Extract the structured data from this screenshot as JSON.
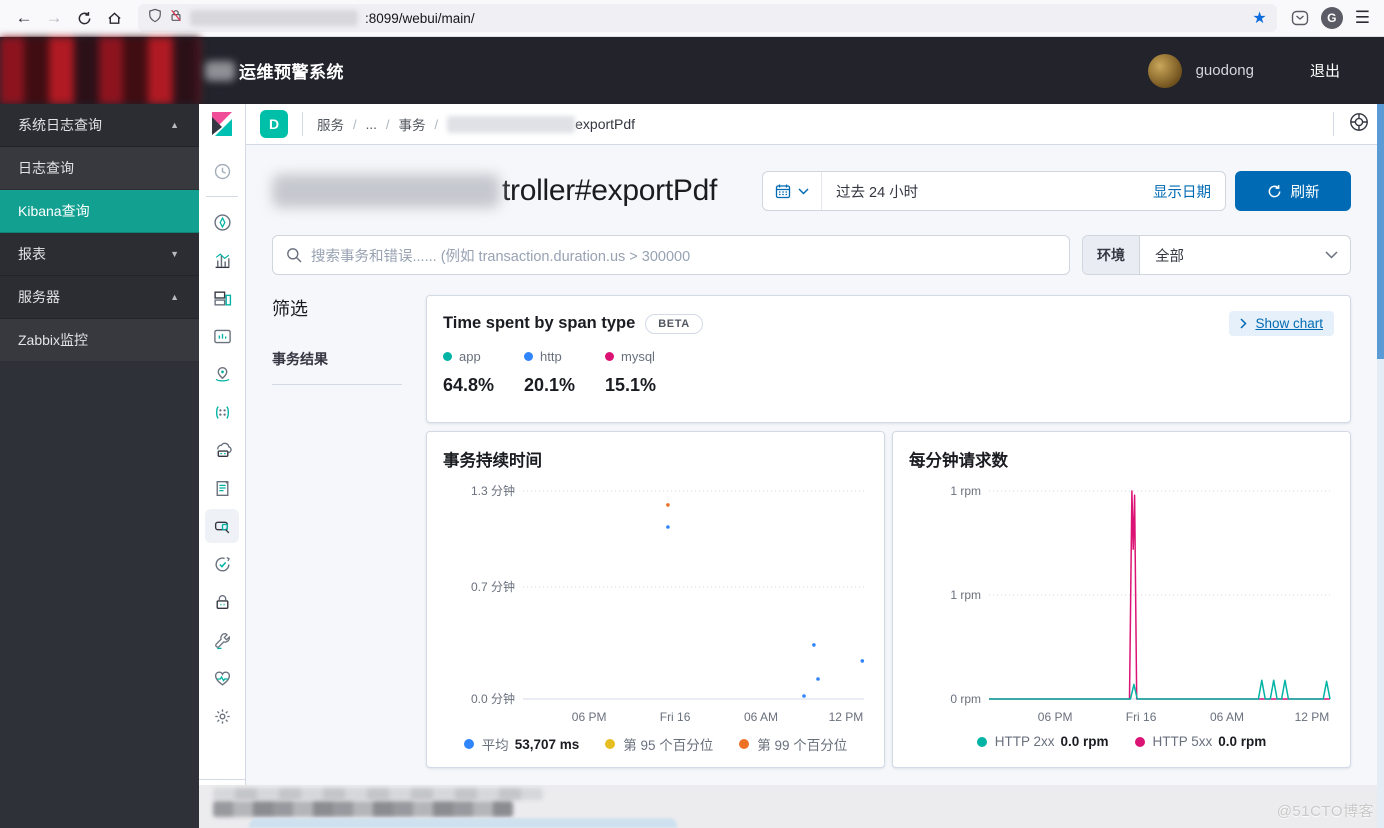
{
  "browser": {
    "url_visible": ":8099/webui/main/"
  },
  "header": {
    "title": "运维预警系统",
    "user": "guodong",
    "logout": "退出"
  },
  "sidebar": {
    "items": [
      {
        "label": "系统日志查询",
        "arrow": "▲"
      },
      {
        "label": "日志查询",
        "arrow": ""
      },
      {
        "label": "Kibana查询",
        "arrow": ""
      },
      {
        "label": "报表",
        "arrow": "▼"
      },
      {
        "label": "服务器",
        "arrow": "▲"
      },
      {
        "label": "Zabbix监控",
        "arrow": ""
      }
    ]
  },
  "breadcrumb": {
    "badge": "D",
    "item1": "服务",
    "item2": "...",
    "item3": "事务",
    "sep": "/",
    "last_visible": "exportPdf"
  },
  "page": {
    "title_visible": "troller#exportPdf"
  },
  "timepicker": {
    "value": "过去 24 小时",
    "show_dates": "显示日期",
    "refresh": "刷新"
  },
  "search": {
    "placeholder": "搜索事务和错误...... (例如 transaction.duration.us > 300000"
  },
  "env": {
    "label": "环境",
    "value": "全部"
  },
  "filter": {
    "title": "筛选",
    "result_label": "事务结果"
  },
  "span_panel": {
    "beta_label": "BETA",
    "show_chart_label": "Show chart"
  },
  "chart_data": [
    {
      "type": "summary",
      "title": "Time spent by span type",
      "items": [
        {
          "label": "app",
          "value": "64.8%",
          "color": "#00B3A4"
        },
        {
          "label": "http",
          "value": "20.1%",
          "color": "#3185FC"
        },
        {
          "label": "mysql",
          "value": "15.1%",
          "color": "#DB1374"
        }
      ]
    },
    {
      "type": "scatter",
      "title": "事务持续时间",
      "ylabel": "分钟",
      "ymax": 1.3,
      "grid": "dotted",
      "legend_position": "bottom-center",
      "y_ticks": [
        {
          "label": "1.3 分钟",
          "value": 1.3
        },
        {
          "label": "0.7 分钟",
          "value": 0.7
        },
        {
          "label": "0.0 分钟",
          "value": 0
        }
      ],
      "x_ticks": [
        {
          "label": "06 PM",
          "frac": 0.194
        },
        {
          "label": "Fri 16",
          "frac": 0.446
        },
        {
          "label": "06 AM",
          "frac": 0.698
        },
        {
          "label": "12 PM",
          "frac": 0.947
        }
      ],
      "series": [
        {
          "name": "平均",
          "type": "scatter",
          "color": "#3185FC",
          "points": [
            [
              0.425,
              1.075
            ],
            [
              0.853,
              0.338
            ],
            [
              0.995,
              0.238
            ],
            [
              0.865,
              0.125
            ],
            [
              0.824,
              0.019
            ]
          ]
        },
        {
          "name": "第 95 个百分位",
          "type": "scatter",
          "color": "#E7BE22",
          "points": []
        },
        {
          "name": "第 99 个百分位",
          "type": "scatter",
          "color": "#EE7125",
          "points": [
            [
              0.425,
              1.213
            ]
          ]
        }
      ],
      "legend": [
        {
          "label": "平均",
          "value": "53,707 ms",
          "color": "#3185FC"
        },
        {
          "label": "第 95 个百分位",
          "value": "",
          "color": "#E7BE22"
        },
        {
          "label": "第 99 个百分位",
          "value": "",
          "color": "#EE7125"
        }
      ]
    },
    {
      "type": "line",
      "title": "每分钟请求数",
      "ylabel": "rpm",
      "ymax": 1.0,
      "grid": "dotted",
      "legend_position": "bottom-center",
      "y_ticks": [
        {
          "label": "1 rpm",
          "value": 1
        },
        {
          "label": "1 rpm",
          "value": 0.5
        },
        {
          "label": "0 rpm",
          "value": 0
        }
      ],
      "x_ticks": [
        {
          "label": "06 PM",
          "frac": 0.194
        },
        {
          "label": "Fri 16",
          "frac": 0.446
        },
        {
          "label": "06 AM",
          "frac": 0.698
        },
        {
          "label": "12 PM",
          "frac": 0.947
        }
      ],
      "series": [
        {
          "name": "HTTP 5xx",
          "type": "line",
          "color": "#DB1374",
          "points": [
            [
              0,
              0
            ],
            [
              0.412,
              0
            ],
            [
              0.419,
              1.0
            ],
            [
              0.423,
              0.72
            ],
            [
              0.427,
              0.98
            ],
            [
              0.433,
              0
            ],
            [
              1,
              0
            ]
          ]
        },
        {
          "name": "HTTP 2xx",
          "type": "line",
          "color": "#00B3A4",
          "points": [
            [
              0,
              0
            ],
            [
              0.415,
              0
            ],
            [
              0.425,
              0.07
            ],
            [
              0.435,
              0
            ],
            [
              0.79,
              0
            ],
            [
              0.8,
              0.09
            ],
            [
              0.81,
              0
            ],
            [
              0.825,
              0
            ],
            [
              0.835,
              0.09
            ],
            [
              0.845,
              0
            ],
            [
              0.858,
              0
            ],
            [
              0.868,
              0.09
            ],
            [
              0.878,
              0
            ],
            [
              0.98,
              0
            ],
            [
              0.99,
              0.085
            ],
            [
              1,
              0
            ]
          ]
        }
      ],
      "legend": [
        {
          "label": "HTTP 2xx",
          "value": "0.0 rpm",
          "color": "#00B3A4"
        },
        {
          "label": "HTTP 5xx",
          "value": "0.0 rpm",
          "color": "#DB1374"
        }
      ]
    }
  ],
  "watermark": "@51CTO博客"
}
